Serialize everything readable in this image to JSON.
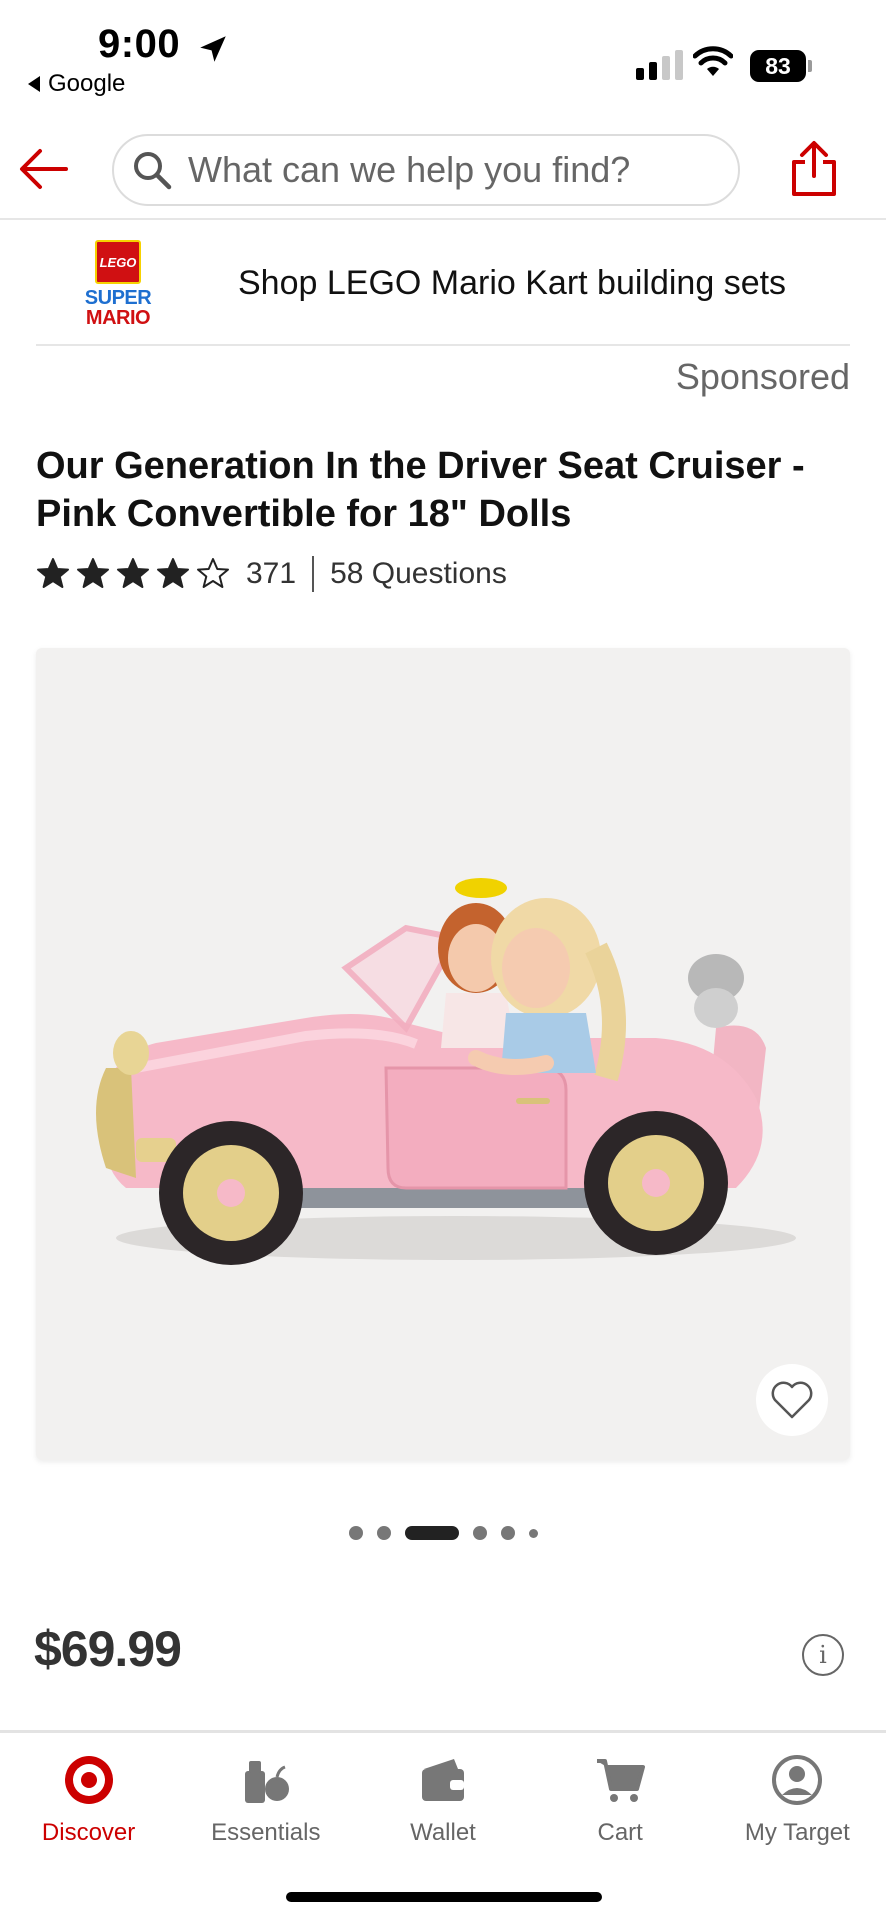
{
  "status_bar": {
    "time": "9:00",
    "back_app": "Google",
    "battery": "83"
  },
  "header": {
    "search_placeholder": "What can we help you find?"
  },
  "sponsor": {
    "logo_box_text": "LEGO",
    "logo_line1": "SUPER",
    "logo_line2": "MARIO",
    "text": "Shop LEGO Mario Kart building sets",
    "label": "Sponsored"
  },
  "product": {
    "title": "Our Generation In the Driver Seat Cruiser - Pink Convertible for 18\" Dolls",
    "rating_stars": 4,
    "rating_max": 5,
    "review_count": "371",
    "questions": "58 Questions",
    "price": "$69.99",
    "info_icon": "i"
  },
  "carousel": {
    "dot_count": 6,
    "active_index": 2
  },
  "colors": {
    "accent": "#cc0000",
    "text": "#111111",
    "muted": "#666666"
  },
  "nav": {
    "items": [
      {
        "label": "Discover",
        "icon": "target-bullseye-icon",
        "active": true
      },
      {
        "label": "Essentials",
        "icon": "essentials-icon",
        "active": false
      },
      {
        "label": "Wallet",
        "icon": "wallet-icon",
        "active": false
      },
      {
        "label": "Cart",
        "icon": "cart-icon",
        "active": false
      },
      {
        "label": "My Target",
        "icon": "account-icon",
        "active": false
      }
    ]
  }
}
